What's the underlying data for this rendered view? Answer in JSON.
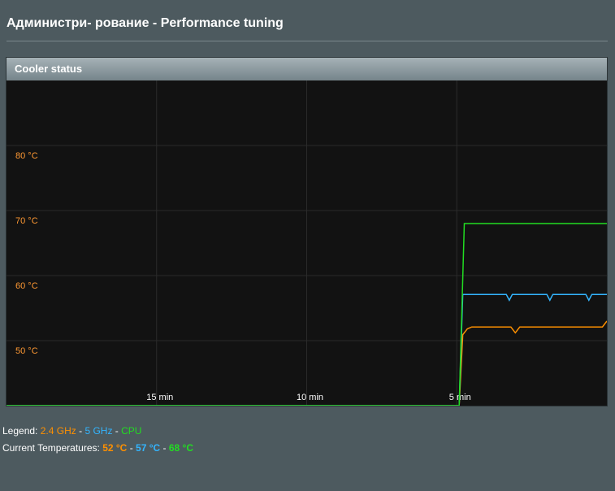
{
  "page": {
    "title": "Администри- рование - Performance tuning"
  },
  "panel": {
    "header": "Cooler status"
  },
  "legend": {
    "prefix": "Legend:",
    "items": [
      "2.4 GHz",
      "5 GHz",
      "CPU"
    ],
    "separator": "-"
  },
  "current": {
    "prefix": "Current Temperatures:",
    "values": [
      "52 °C",
      "57 °C",
      "68 °C"
    ]
  },
  "colors": {
    "ghz24": "#ff9000",
    "ghz5": "#33b5ff",
    "cpu": "#22dd22",
    "grid": "#2a2a2a",
    "tick_label": "#ff9933",
    "background": "#121212"
  },
  "chart_data": {
    "type": "line",
    "title": "Cooler status",
    "ylabel": "",
    "xlabel": "",
    "y_ticks": [
      "50 °C",
      "60 °C",
      "70 °C",
      "80 °C"
    ],
    "y_tick_values": [
      50,
      60,
      70,
      80
    ],
    "ylim": [
      40,
      90
    ],
    "x_ticks": [
      "15 min",
      "10 min",
      "5 min"
    ],
    "x_tick_values": [
      15,
      10,
      5
    ],
    "xlim": [
      20,
      0
    ],
    "grid": true,
    "series": [
      {
        "name": "2.4 GHz",
        "color": "#ff9000",
        "points": [
          [
            20,
            40
          ],
          [
            4.92,
            40
          ],
          [
            4.8,
            50.9
          ],
          [
            4.65,
            51.8
          ],
          [
            4.5,
            52.1
          ],
          [
            3.2,
            52.1
          ],
          [
            3.05,
            51.2
          ],
          [
            2.9,
            52.1
          ],
          [
            0.15,
            52.1
          ],
          [
            0,
            53
          ]
        ]
      },
      {
        "name": "5 GHz",
        "color": "#33b5ff",
        "points": [
          [
            20,
            40
          ],
          [
            4.92,
            40
          ],
          [
            4.8,
            57.1
          ],
          [
            3.35,
            57.1
          ],
          [
            3.25,
            56.2
          ],
          [
            3.15,
            57.1
          ],
          [
            2.0,
            57.1
          ],
          [
            1.9,
            56.2
          ],
          [
            1.8,
            57.1
          ],
          [
            0.7,
            57.1
          ],
          [
            0.6,
            56.2
          ],
          [
            0.5,
            57.1
          ],
          [
            0,
            57.1
          ]
        ]
      },
      {
        "name": "CPU",
        "color": "#22dd22",
        "points": [
          [
            20,
            40
          ],
          [
            4.92,
            40
          ],
          [
            4.75,
            68
          ],
          [
            0,
            68
          ]
        ]
      }
    ]
  }
}
